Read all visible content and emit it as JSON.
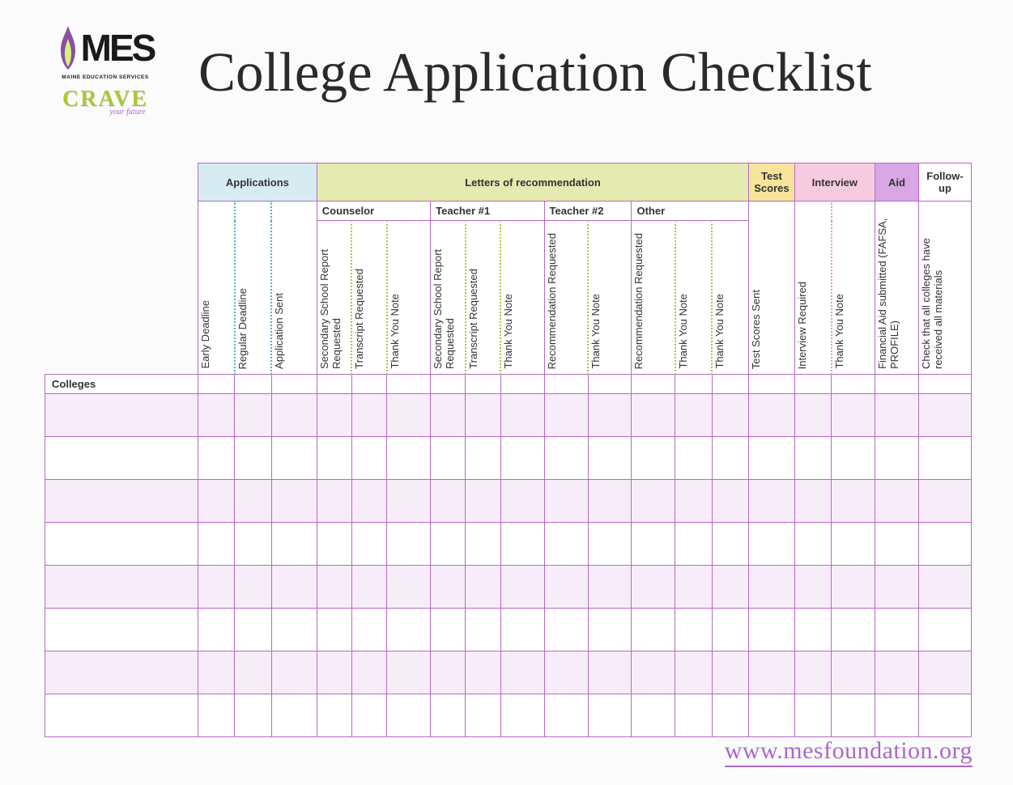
{
  "title": "College Application Checklist",
  "logo": {
    "mes_text": "MES",
    "mes_subtitle": "MAINE EDUCATION SERVICES",
    "crave_text": "CRAVE",
    "crave_subtitle": "your future"
  },
  "categories": {
    "applications": "Applications",
    "letters": "Letters of recommendation",
    "test_scores": "Test Scores",
    "interview": "Interview",
    "aid": "Aid",
    "followup": "Follow-up"
  },
  "subcategories": {
    "counselor": "Counselor",
    "teacher1": "Teacher #1",
    "teacher2": "Teacher #2",
    "other": "Other"
  },
  "columns": {
    "early_deadline": "Early Deadline",
    "regular_deadline": "Regular Deadline",
    "application_sent": "Application Sent",
    "secondary_school_report": "Secondary School Report Requested",
    "transcript_requested": "Transcript Requested",
    "thank_you_note": "Thank You Note",
    "recommendation_requested": "Recommendation Requested",
    "test_scores_sent": "Test Scores Sent",
    "interview_required": "Interview Required",
    "financial_aid": "Financial Aid submitted (FAFSA, PROFILE)",
    "check_materials": "Check that all colleges have received all materials"
  },
  "row_label": "Colleges",
  "num_data_rows": 8,
  "footer_url": "www.mesfoundation.org",
  "colors": {
    "border": "#b868c5",
    "applications": "#d6ecf2",
    "letters": "#e5eab0",
    "test_scores": "#f7e49a",
    "interview": "#f6cbe0",
    "aid": "#d8a7e4"
  }
}
